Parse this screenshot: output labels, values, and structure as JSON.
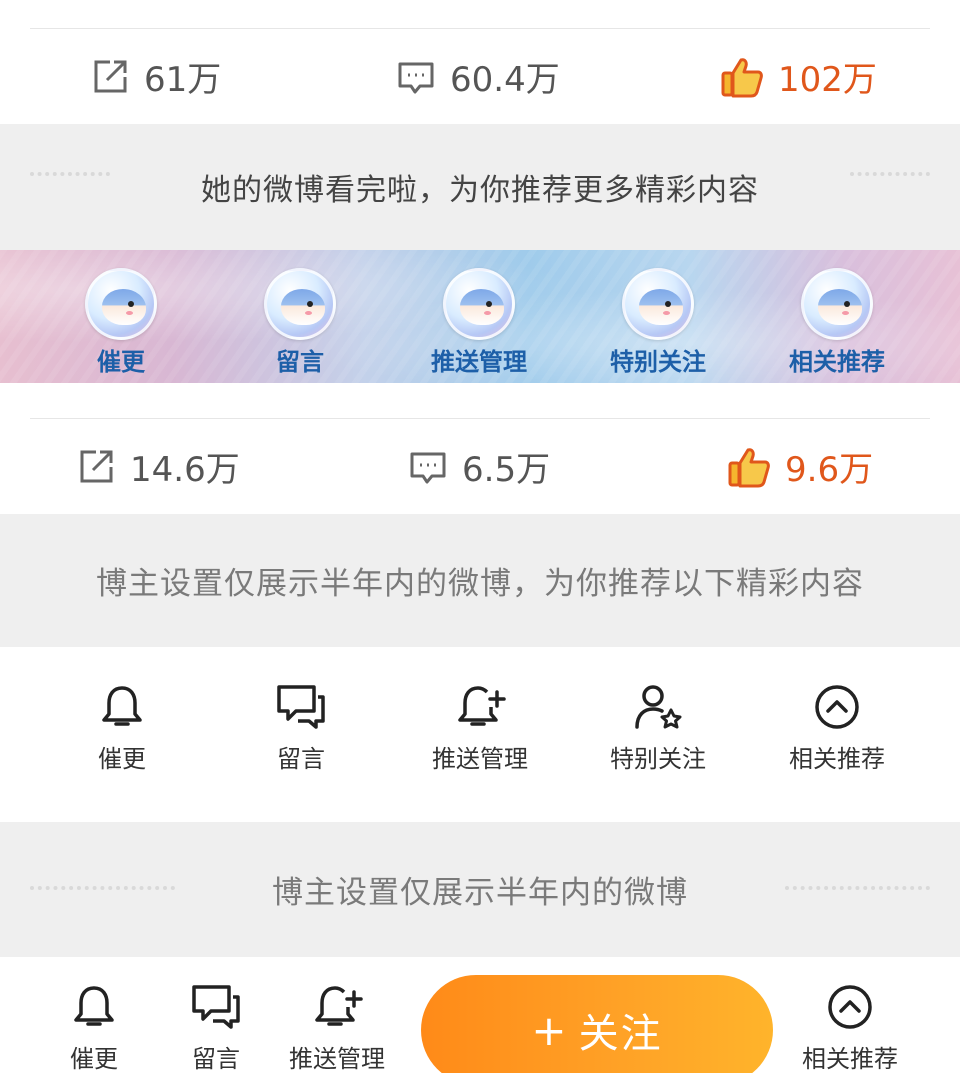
{
  "post1": {
    "repost": "61万",
    "comment": "60.4万",
    "like": "102万"
  },
  "band1": {
    "text": "她的微博看完啦，为你推荐更多精彩内容"
  },
  "fish_bar": {
    "items": [
      "催更",
      "留言",
      "推送管理",
      "特别关注",
      "相关推荐"
    ]
  },
  "post2": {
    "repost": "14.6万",
    "comment": "6.5万",
    "like": "9.6万"
  },
  "band2": {
    "text": "博主设置仅展示半年内的微博，为你推荐以下精彩内容"
  },
  "action_bar": {
    "items": [
      "催更",
      "留言",
      "推送管理",
      "特别关注",
      "相关推荐"
    ]
  },
  "band3": {
    "text": "博主设置仅展示半年内的微博"
  },
  "bottom_bar": {
    "urge": "催更",
    "message": "留言",
    "push": "推送管理",
    "follow_plus": "+",
    "follow": "关注",
    "related": "相关推荐"
  },
  "colors": {
    "like": "#e0571b",
    "follow_gradient_start": "#ff8a18",
    "follow_gradient_end": "#ffb42b",
    "fish_label": "#1d5fa8"
  }
}
